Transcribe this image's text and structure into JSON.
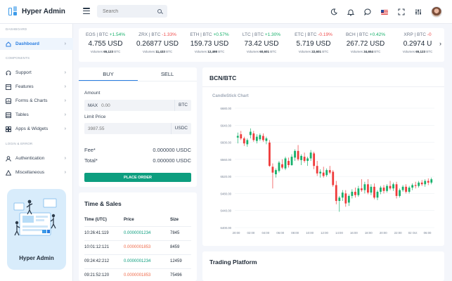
{
  "header": {
    "brand": "Hyper Admin",
    "search_placeholder": "Search"
  },
  "sidebar": {
    "sections": [
      "DASHBOARD",
      "COMPONENTS",
      "LOGIN & ERROR"
    ],
    "items": [
      {
        "label": "Dashboard",
        "icon": "home-icon",
        "active": true
      },
      {
        "label": "Support",
        "icon": "headset-icon"
      },
      {
        "label": "Features",
        "icon": "grid-icon"
      },
      {
        "label": "Forms & Charts",
        "icon": "chart-icon"
      },
      {
        "label": "Tables",
        "icon": "table-icon"
      },
      {
        "label": "Apps & Widgets",
        "icon": "apps-icon"
      },
      {
        "label": "Authentication",
        "icon": "user-icon"
      },
      {
        "label": "Miscellaneous",
        "icon": "triangle-icon"
      }
    ],
    "promo_title": "Hyper Admin"
  },
  "tickers": [
    {
      "pair": "EOS | BTC",
      "change": "+1.54%",
      "dir": "up",
      "price": "4.755 USD",
      "vol_label": "Volumes",
      "vol": "65,123",
      "vol_unit": "BTC"
    },
    {
      "pair": "ZRX | BTC",
      "change": "-1.33%",
      "dir": "down",
      "price": "0.26877 USD",
      "vol_label": "Volumes",
      "vol": "11,433",
      "vol_unit": "BTC"
    },
    {
      "pair": "ETH | BTC",
      "change": "+0.57%",
      "dir": "up",
      "price": "159.73 USD",
      "vol_label": "Volumes",
      "vol": "12,498",
      "vol_unit": "BTC"
    },
    {
      "pair": "LTC | BTC",
      "change": "+1.30%",
      "dir": "up",
      "price": "73.42 USD",
      "vol_label": "Volumes",
      "vol": "60,601",
      "vol_unit": "BTC"
    },
    {
      "pair": "ETC | BTC",
      "change": "-0.19%",
      "dir": "down",
      "price": "5.719 USD",
      "vol_label": "Volumes",
      "vol": "22,601",
      "vol_unit": "BTC"
    },
    {
      "pair": "BCH | BTC",
      "change": "+0.42%",
      "dir": "up",
      "price": "267.72 USD",
      "vol_label": "Volumes",
      "vol": "34,654",
      "vol_unit": "BTC"
    },
    {
      "pair": "XRP | BTC",
      "change": "-0",
      "dir": "down",
      "price": "0.2974 U",
      "vol_label": "Volumes",
      "vol": "65,123",
      "vol_unit": "BTC"
    }
  ],
  "order": {
    "tab_buy": "BUY",
    "tab_sell": "SELL",
    "amount_label": "Amount",
    "amount_prefix": "MAX",
    "amount_value": "0.00",
    "amount_unit": "BTC",
    "limit_label": "Limit Price",
    "limit_value": "3987.55",
    "limit_unit": "USDC",
    "fee_label": "Fee*",
    "fee_value": "0.000000 USDC",
    "total_label": "Total*",
    "total_value": "0.000000 USDC",
    "submit_label": "PLACE ORDER"
  },
  "sales": {
    "title": "Time & Sales",
    "columns": [
      "Time (UTC)",
      "Price",
      "Size"
    ],
    "rows": [
      {
        "time": "10:26:41:119",
        "price": "0.0000001234",
        "dir": "up",
        "size": "7845"
      },
      {
        "time": "10:01:12:121",
        "price": "0.0000001853",
        "dir": "down",
        "size": "8459"
      },
      {
        "time": "09:24:42:212",
        "price": "0.0000001234",
        "dir": "up",
        "size": "12459"
      },
      {
        "time": "09:21:52:120",
        "price": "0.0000001853",
        "dir": "down",
        "size": "75496"
      }
    ]
  },
  "chart_card": {
    "title": "BCN/BTC",
    "platform_title": "Trading Platform"
  },
  "chart_data": {
    "type": "candlestick",
    "title": "CandleStick Chart",
    "ylim": [
      6380,
      6680
    ],
    "y_ticks": [
      "6680.00",
      "6640.00",
      "6600.00",
      "6560.00",
      "6520.00",
      "6480.00",
      "6440.00",
      "6400.00"
    ],
    "x_ticks": [
      "20:00",
      "02:00",
      "04:00",
      "06:00",
      "08:00",
      "10:00",
      "12:00",
      "14:00",
      "16:00",
      "18:00",
      "20:00",
      "22:00",
      "02 Oct",
      "06:00"
    ],
    "up_color": "#17b06b",
    "down_color": "#ef3b3b",
    "candles": [
      {
        "o": 6596,
        "h": 6608,
        "l": 6582,
        "c": 6600
      },
      {
        "o": 6604,
        "h": 6612,
        "l": 6590,
        "c": 6594
      },
      {
        "o": 6594,
        "h": 6598,
        "l": 6576,
        "c": 6582
      },
      {
        "o": 6580,
        "h": 6594,
        "l": 6574,
        "c": 6590
      },
      {
        "o": 6602,
        "h": 6618,
        "l": 6594,
        "c": 6610
      },
      {
        "o": 6606,
        "h": 6612,
        "l": 6586,
        "c": 6590
      },
      {
        "o": 6588,
        "h": 6604,
        "l": 6582,
        "c": 6598
      },
      {
        "o": 6592,
        "h": 6606,
        "l": 6588,
        "c": 6602
      },
      {
        "o": 6600,
        "h": 6606,
        "l": 6586,
        "c": 6590
      },
      {
        "o": 6588,
        "h": 6598,
        "l": 6580,
        "c": 6594
      },
      {
        "o": 6584,
        "h": 6590,
        "l": 6526,
        "c": 6528
      },
      {
        "o": 6526,
        "h": 6534,
        "l": 6474,
        "c": 6512
      },
      {
        "o": 6508,
        "h": 6522,
        "l": 6500,
        "c": 6518
      },
      {
        "o": 6516,
        "h": 6540,
        "l": 6512,
        "c": 6536
      },
      {
        "o": 6532,
        "h": 6544,
        "l": 6520,
        "c": 6524
      },
      {
        "o": 6522,
        "h": 6550,
        "l": 6518,
        "c": 6546
      },
      {
        "o": 6540,
        "h": 6548,
        "l": 6524,
        "c": 6530
      },
      {
        "o": 6530,
        "h": 6556,
        "l": 6528,
        "c": 6550
      },
      {
        "o": 6548,
        "h": 6568,
        "l": 6540,
        "c": 6564
      },
      {
        "o": 6564,
        "h": 6578,
        "l": 6540,
        "c": 6544
      },
      {
        "o": 6542,
        "h": 6556,
        "l": 6530,
        "c": 6552
      },
      {
        "o": 6550,
        "h": 6560,
        "l": 6536,
        "c": 6540
      },
      {
        "o": 6540,
        "h": 6550,
        "l": 6528,
        "c": 6546
      },
      {
        "o": 6546,
        "h": 6566,
        "l": 6540,
        "c": 6560
      },
      {
        "o": 6558,
        "h": 6562,
        "l": 6520,
        "c": 6528
      },
      {
        "o": 6528,
        "h": 6540,
        "l": 6504,
        "c": 6510
      },
      {
        "o": 6510,
        "h": 6520,
        "l": 6500,
        "c": 6514
      },
      {
        "o": 6512,
        "h": 6526,
        "l": 6500,
        "c": 6504
      },
      {
        "o": 6506,
        "h": 6522,
        "l": 6502,
        "c": 6518
      },
      {
        "o": 6518,
        "h": 6528,
        "l": 6508,
        "c": 6512
      },
      {
        "o": 6514,
        "h": 6518,
        "l": 6478,
        "c": 6482
      },
      {
        "o": 6482,
        "h": 6492,
        "l": 6436,
        "c": 6444
      },
      {
        "o": 6444,
        "h": 6456,
        "l": 6418,
        "c": 6452
      },
      {
        "o": 6452,
        "h": 6470,
        "l": 6444,
        "c": 6464
      },
      {
        "o": 6462,
        "h": 6470,
        "l": 6430,
        "c": 6438
      },
      {
        "o": 6440,
        "h": 6460,
        "l": 6432,
        "c": 6456
      },
      {
        "o": 6456,
        "h": 6472,
        "l": 6450,
        "c": 6466
      },
      {
        "o": 6466,
        "h": 6476,
        "l": 6452,
        "c": 6458
      },
      {
        "o": 6458,
        "h": 6480,
        "l": 6454,
        "c": 6474
      },
      {
        "o": 6474,
        "h": 6496,
        "l": 6466,
        "c": 6470
      },
      {
        "o": 6470,
        "h": 6490,
        "l": 6462,
        "c": 6484
      },
      {
        "o": 6484,
        "h": 6496,
        "l": 6460,
        "c": 6464
      },
      {
        "o": 6464,
        "h": 6484,
        "l": 6458,
        "c": 6478
      },
      {
        "o": 6478,
        "h": 6486,
        "l": 6448,
        "c": 6452
      },
      {
        "o": 6452,
        "h": 6470,
        "l": 6446,
        "c": 6466
      },
      {
        "o": 6466,
        "h": 6480,
        "l": 6460,
        "c": 6476
      },
      {
        "o": 6476,
        "h": 6482,
        "l": 6462,
        "c": 6468
      },
      {
        "o": 6468,
        "h": 6484,
        "l": 6464,
        "c": 6480
      },
      {
        "o": 6480,
        "h": 6492,
        "l": 6470,
        "c": 6474
      },
      {
        "o": 6474,
        "h": 6488,
        "l": 6468,
        "c": 6484
      },
      {
        "o": 6484,
        "h": 6490,
        "l": 6450,
        "c": 6456
      },
      {
        "o": 6456,
        "h": 6474,
        "l": 6452,
        "c": 6470
      },
      {
        "o": 6470,
        "h": 6482,
        "l": 6466,
        "c": 6478
      },
      {
        "o": 6478,
        "h": 6484,
        "l": 6462,
        "c": 6466
      },
      {
        "o": 6466,
        "h": 6480,
        "l": 6462,
        "c": 6476
      },
      {
        "o": 6476,
        "h": 6486,
        "l": 6470,
        "c": 6482
      },
      {
        "o": 6482,
        "h": 6490,
        "l": 6474,
        "c": 6480
      },
      {
        "o": 6480,
        "h": 6492,
        "l": 6476,
        "c": 6488
      },
      {
        "o": 6488,
        "h": 6494,
        "l": 6480,
        "c": 6484
      },
      {
        "o": 6484,
        "h": 6496,
        "l": 6478,
        "c": 6492
      },
      {
        "o": 6492,
        "h": 6498,
        "l": 6482,
        "c": 6488
      },
      {
        "o": 6488,
        "h": 6500,
        "l": 6484,
        "c": 6496
      }
    ]
  }
}
